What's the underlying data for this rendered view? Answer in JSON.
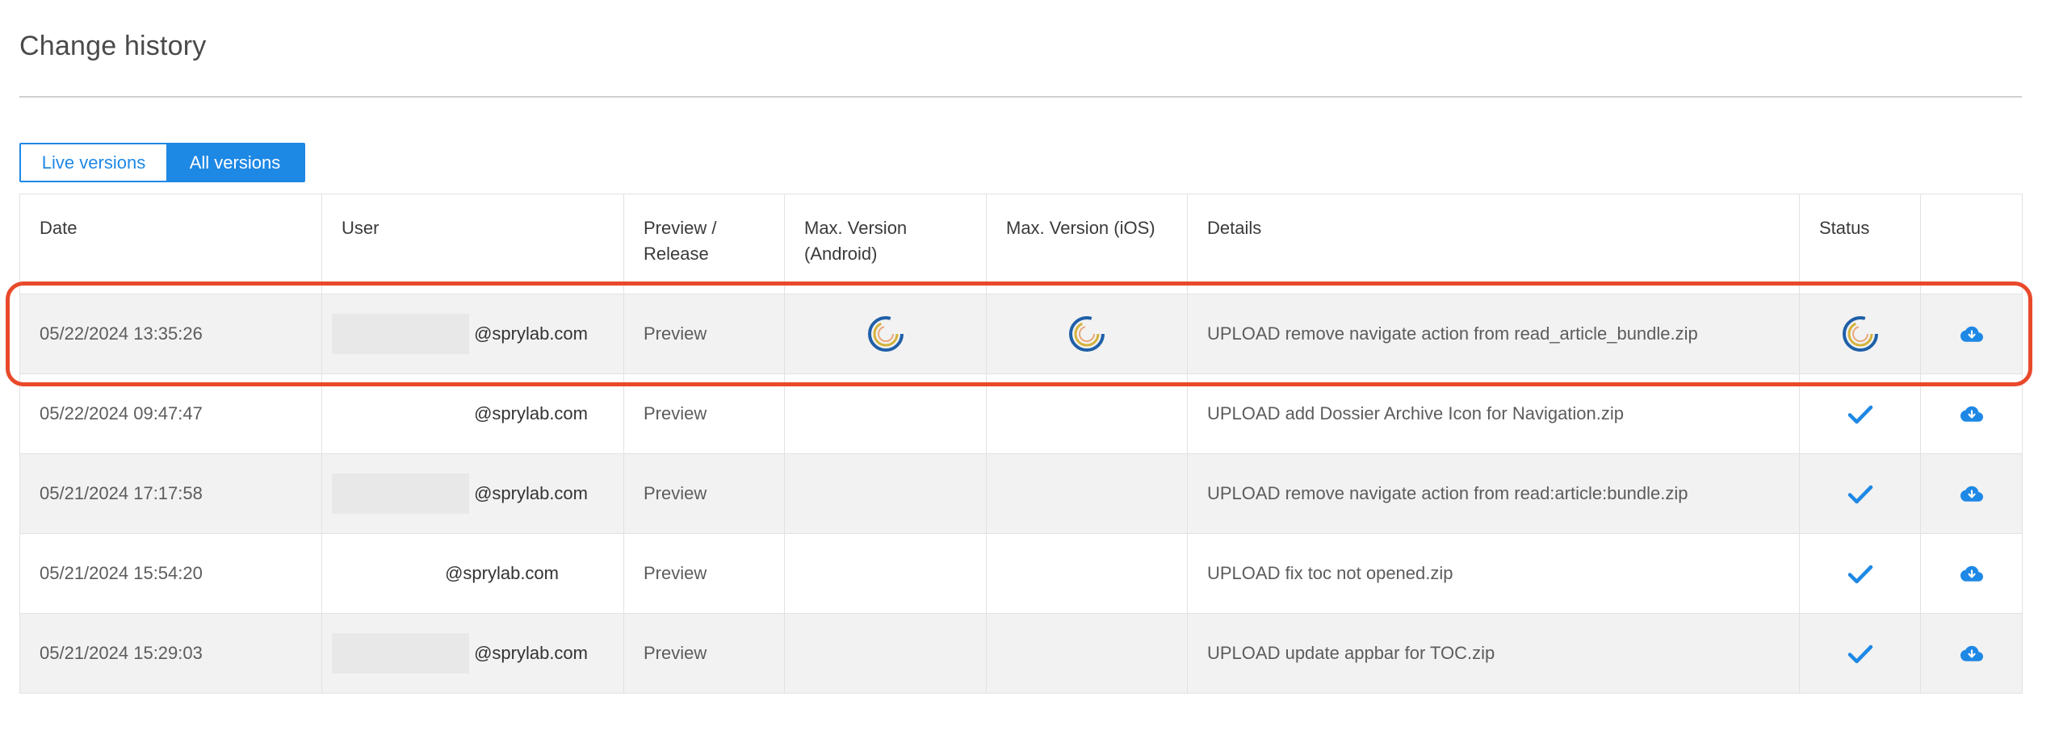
{
  "page": {
    "title": "Change history"
  },
  "toggle": {
    "live_label": "Live versions",
    "all_label": "All versions",
    "active": "all"
  },
  "table": {
    "headers": {
      "date": "Date",
      "user": "User",
      "preview_release_line1": "Preview /",
      "preview_release_line2": "Release",
      "max_android_line1": "Max. Version",
      "max_android_line2": "(Android)",
      "max_ios": "Max. Version (iOS)",
      "details": "Details",
      "status": "Status"
    },
    "rows": [
      {
        "date": "05/22/2024 13:35:26",
        "user": "@sprylab.com",
        "type": "Preview",
        "android": "loading-icon",
        "ios": "loading-icon",
        "details": "UPLOAD remove navigate action from read_article_bundle.zip",
        "status": "loading-icon",
        "highlighted": true
      },
      {
        "date": "05/22/2024 09:47:47",
        "user": "@sprylab.com",
        "type": "Preview",
        "android": "",
        "ios": "",
        "details": "UPLOAD add Dossier Archive Icon for Navigation.zip",
        "status": "check-icon"
      },
      {
        "date": "05/21/2024 17:17:58",
        "user": "@sprylab.com",
        "type": "Preview",
        "android": "",
        "ios": "",
        "details": "UPLOAD remove navigate action from read:article:bundle.zip",
        "status": "check-icon"
      },
      {
        "date": "05/21/2024 15:54:20",
        "user": "@sprylab.com",
        "type": "Preview",
        "android": "",
        "ios": "",
        "details": "UPLOAD fix toc not opened.zip",
        "status": "check-icon"
      },
      {
        "date": "05/21/2024 15:29:03",
        "user": "@sprylab.com",
        "type": "Preview",
        "android": "",
        "ios": "",
        "details": "UPLOAD update appbar for TOC.zip",
        "status": "check-icon"
      }
    ]
  },
  "colors": {
    "accent": "#1e88e5",
    "highlight": "#e8492b",
    "spinner_blue": "#1f5fa8",
    "spinner_yellow": "#d4b23a",
    "spinner_orange": "#e9a77a"
  }
}
